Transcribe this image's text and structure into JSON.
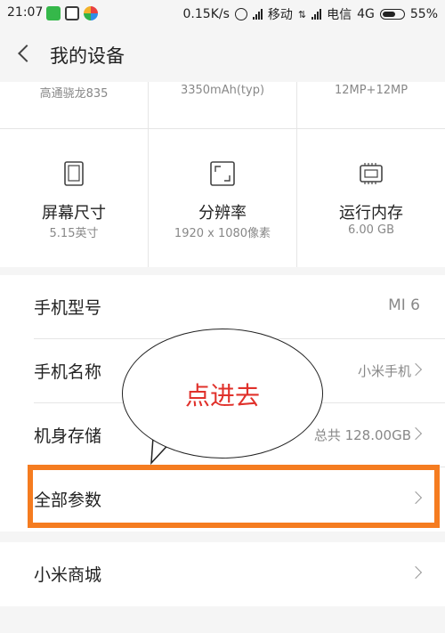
{
  "status_bar": {
    "time": "21:07",
    "speed": "0.15K/s",
    "carrier1": "移动",
    "carrier2": "电信",
    "network": "4G",
    "battery": "55%",
    "battery_level": 0.55,
    "app_icons": [
      "wechat-icon",
      "video-app-icon",
      "color-app-icon"
    ]
  },
  "header": {
    "title": "我的设备"
  },
  "specs_top": [
    "高通骁龙835",
    "3350mAh(typ)",
    "12MP+12MP"
  ],
  "specs": [
    {
      "icon": "screen-size-icon",
      "label": "屏幕尺寸",
      "value": "5.15英寸"
    },
    {
      "icon": "resolution-icon",
      "label": "分辨率",
      "value": "1920 x 1080像素"
    },
    {
      "icon": "memory-chip-icon",
      "label": "运行内存",
      "value": "6.00 GB"
    }
  ],
  "info": {
    "model": {
      "label": "手机型号",
      "value": "MI 6"
    },
    "name": {
      "label": "手机名称",
      "value": "小米手机"
    },
    "storage": {
      "label": "机身存储",
      "value": "总共 128.00GB"
    },
    "all_params": {
      "label": "全部参数"
    },
    "mi_store": {
      "label": "小米商城"
    }
  },
  "annotation": {
    "text": "点进去",
    "highlight_color": "#f57c20",
    "text_color": "#e0312b"
  },
  "colors": {
    "background": "#f5f5f5",
    "card": "#ffffff",
    "secondary_text": "#888888"
  }
}
